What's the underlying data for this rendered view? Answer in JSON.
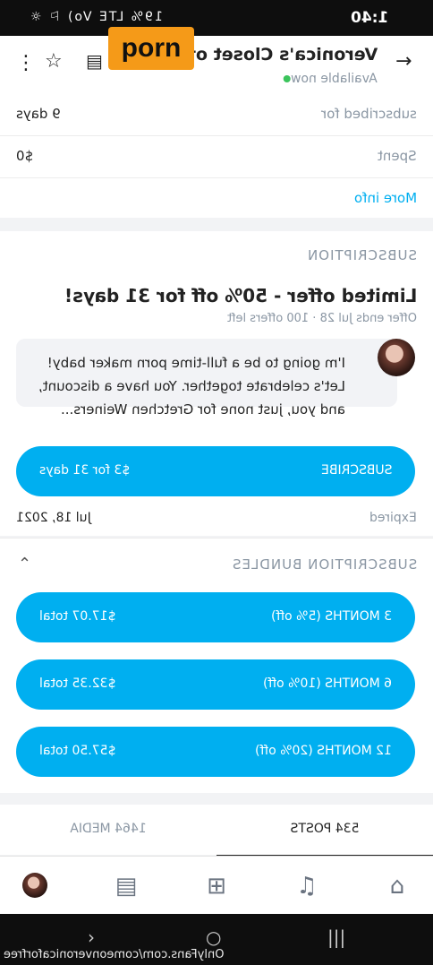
{
  "status_bar": {
    "time": "1:40",
    "icons": "19% LTE Vo) ⚐ ☼"
  },
  "header": {
    "title": "Veronica's Closet of I",
    "status": "Available now",
    "overlay_tag": "porn",
    "icons": [
      "back-arrow-icon",
      "list-icon",
      "star-icon",
      "more-icon"
    ]
  },
  "info": {
    "subscribed_label": "subscribed for",
    "subscribed_value": "9 days",
    "spent_label": "Spent",
    "spent_value": "$0",
    "more_info": "More info"
  },
  "subscription": {
    "heading": "SUBSCRIPTION",
    "offer_title": "Limited offer - 50% off for 31 days!",
    "offer_meta": "Offer ends Jul 28 · 100 offers left",
    "message": "I'm going to be a full-time porn maker baby! Let's celebrate together. You have a discount, and you, just none for Gretchen Weiners...",
    "subscribe_label": "SUBSCRIBE",
    "subscribe_price": "$3 for 31 days",
    "expired_label": "Expired",
    "expired_date": "Jul 18, 2021"
  },
  "bundles": {
    "heading": "SUBSCRIPTION BUNDLES",
    "items": [
      {
        "label": "3 MONTHS (5% off)",
        "price": "$17.07 total"
      },
      {
        "label": "6 MONTHS (10% off)",
        "price": "$32.35 total"
      },
      {
        "label": "12 MONTHS (20% off)",
        "price": "$57.50 total"
      }
    ]
  },
  "tabs": {
    "posts": "534 POSTS",
    "media": "1464 MEDIA"
  },
  "watermark": "OnlyFans.com/comeonveronicaforfree",
  "colors": {
    "accent": "#00aff0",
    "online": "#3bc45c",
    "tag": "#f59a18"
  }
}
